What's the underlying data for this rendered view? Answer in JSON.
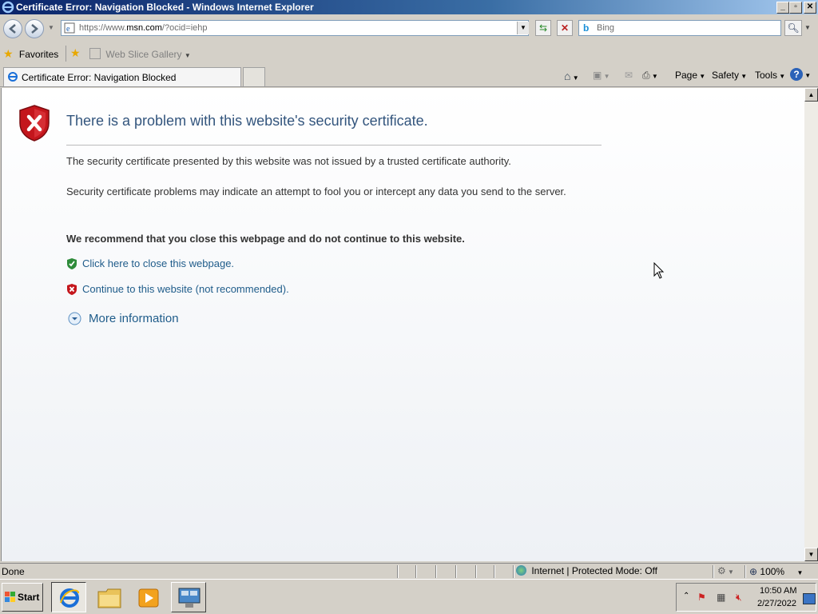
{
  "window": {
    "title": "Certificate Error: Navigation Blocked - Windows Internet Explorer"
  },
  "nav": {
    "address_prefix": "https://www.",
    "address_domain": "msn.com",
    "address_suffix": "/?ocid=iehp",
    "search_placeholder": "Bing"
  },
  "favorites_bar": {
    "favorites_label": "Favorites",
    "web_slice_label": "Web Slice Gallery"
  },
  "tab": {
    "label": "Certificate Error: Navigation Blocked"
  },
  "command_bar": {
    "page_label": "Page",
    "safety_label": "Safety",
    "tools_label": "Tools"
  },
  "content": {
    "heading": "There is a problem with this website's security certificate.",
    "para1": "The security certificate presented by this website was not issued by a trusted certificate authority.",
    "para2": "Security certificate problems may indicate an attempt to fool you or intercept any data you send to the server.",
    "recommendation": "We recommend that you close this webpage and do not continue to this website.",
    "close_link": "Click here to close this webpage.",
    "continue_link": "Continue to this website (not recommended).",
    "more_info": "More information"
  },
  "status_bar": {
    "status": "Done",
    "zone": "Internet | Protected Mode: Off",
    "zoom": "100%"
  },
  "taskbar": {
    "start_label": "Start",
    "time": "10:50 AM",
    "date": "2/27/2022"
  },
  "colors": {
    "link": "#1f5c8a",
    "heading": "#33557d",
    "error_red": "#c4161c",
    "ok_green": "#2e8b3a"
  }
}
